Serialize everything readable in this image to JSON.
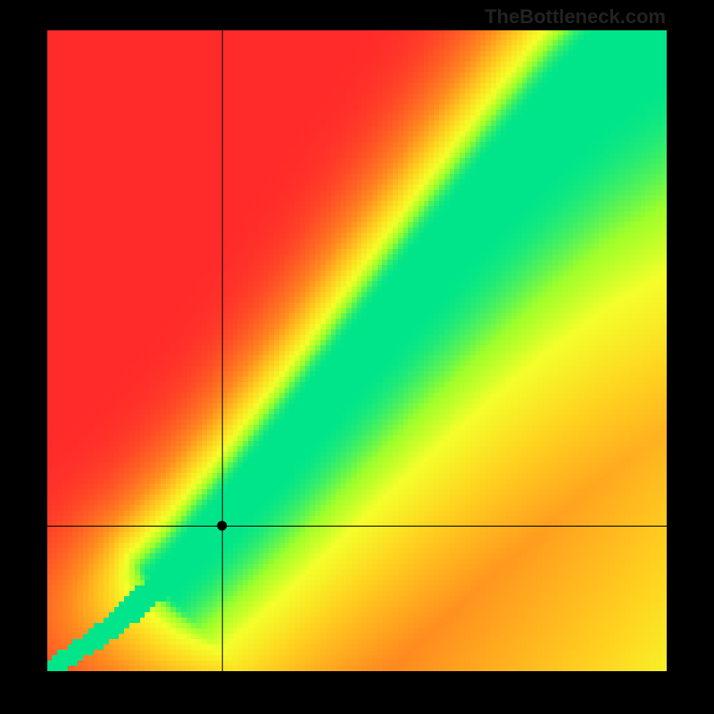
{
  "watermark": "TheBottleneck.com",
  "chart_data": {
    "type": "heatmap",
    "title": "",
    "xlabel": "",
    "ylabel": "",
    "xlim": [
      0,
      1
    ],
    "ylim": [
      0,
      1
    ],
    "crosshair": {
      "x": 0.282,
      "y": 0.227
    },
    "marker": {
      "x": 0.282,
      "y": 0.227
    },
    "colormap": {
      "stops": [
        {
          "v": 0.0,
          "color": "#ff2a2a"
        },
        {
          "v": 0.45,
          "color": "#ff8a1f"
        },
        {
          "v": 0.7,
          "color": "#ffd21f"
        },
        {
          "v": 0.85,
          "color": "#f4ff2a"
        },
        {
          "v": 0.93,
          "color": "#9fff2a"
        },
        {
          "v": 1.0,
          "color": "#00e58a"
        }
      ]
    },
    "ridge": {
      "description": "Optimal matching curve y ≈ f(x); green band where |y - f(x)| small",
      "curve_points": [
        {
          "x": 0.0,
          "y": 0.0
        },
        {
          "x": 0.1,
          "y": 0.065
        },
        {
          "x": 0.2,
          "y": 0.15
        },
        {
          "x": 0.3,
          "y": 0.255
        },
        {
          "x": 0.4,
          "y": 0.37
        },
        {
          "x": 0.5,
          "y": 0.49
        },
        {
          "x": 0.6,
          "y": 0.61
        },
        {
          "x": 0.7,
          "y": 0.725
        },
        {
          "x": 0.8,
          "y": 0.835
        },
        {
          "x": 0.9,
          "y": 0.935
        },
        {
          "x": 1.0,
          "y": 1.02
        }
      ],
      "green_halfwidth_at_0": 0.015,
      "green_halfwidth_at_1": 0.085
    },
    "grid_resolution": 120
  }
}
